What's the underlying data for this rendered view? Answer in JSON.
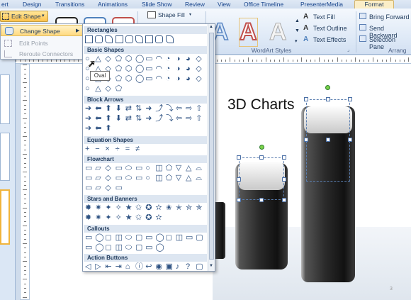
{
  "tabs": [
    {
      "label": "ert"
    },
    {
      "label": "Design"
    },
    {
      "label": "Transitions"
    },
    {
      "label": "Animations"
    },
    {
      "label": "Slide Show"
    },
    {
      "label": "Review"
    },
    {
      "label": "View"
    },
    {
      "label": "Office Timeline"
    },
    {
      "label": "PresenterMedia"
    },
    {
      "label": "Format"
    }
  ],
  "ribbon": {
    "edit_shape": "Edit Shape",
    "shape_fill": "Shape Fill",
    "wordart_letter": "A",
    "wordart_group": "WordArt Styles",
    "text_fill": "Text Fill",
    "text_outline": "Text Outline",
    "text_effects": "Text Effects",
    "bring_forward": "Bring Forward",
    "send_backward": "Send Backward",
    "selection_pane": "Selection Pane",
    "arrange_group": "Arrang"
  },
  "edit_menu": {
    "change_shape": "Change Shape",
    "edit_points": "Edit Points",
    "reroute": "Reroute Connectors"
  },
  "gallery": {
    "sections": [
      {
        "title": "Rectangles"
      },
      {
        "title": "Basic Shapes"
      },
      {
        "title": "Block Arrows"
      },
      {
        "title": "Equation Shapes"
      },
      {
        "title": "Flowchart"
      },
      {
        "title": "Stars and Banners"
      },
      {
        "title": "Callouts"
      },
      {
        "title": "Action Buttons"
      }
    ],
    "tooltip": "Oval"
  },
  "slide": {
    "title": "3D Charts",
    "number": "3"
  },
  "colors": {
    "accent": "#fbeec7",
    "ribbon": "#dde8f6",
    "handle_green": "#7bd14b",
    "bar": "#2a2a2a"
  }
}
